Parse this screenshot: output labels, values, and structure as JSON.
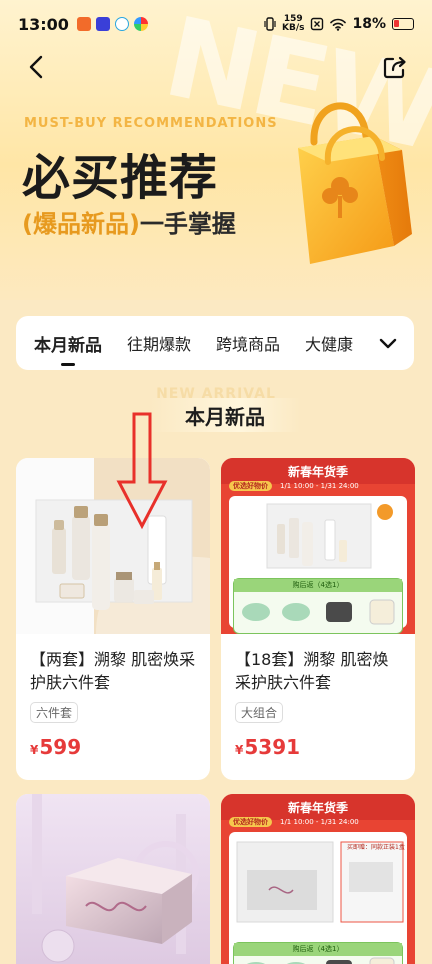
{
  "status_bar": {
    "time": "13:00",
    "net_speed_value": "159",
    "net_speed_unit": "KB/s",
    "battery": "18%"
  },
  "hero": {
    "bg_word": "NEW",
    "en_caption": "MUST-BUY RECOMMENDATIONS",
    "title": "必买推荐",
    "subtitle_accent": "(爆品新品)",
    "subtitle_rest": "一手掌握"
  },
  "tabs": {
    "items": [
      "本月新品",
      "往期爆款",
      "跨境商品",
      "大健康"
    ],
    "active_index": 0
  },
  "section": {
    "ghost_en": "NEW ARRIVAL",
    "title": "本月新品"
  },
  "products": [
    {
      "name": "【两套】溯黎 肌密焕采护肤六件套",
      "tag": "六件套",
      "currency": "¥",
      "price": "599"
    },
    {
      "name": "【18套】溯黎 肌密焕采护肤六件套",
      "tag": "大组合",
      "currency": "¥",
      "price": "5391",
      "promo_title": "新春年货季",
      "promo_pill": "优选好物价",
      "promo_date": "1/1 10:00 - 1/31 24:00",
      "gift_title": "购后返（4选1）"
    },
    {
      "name": "",
      "tag": "",
      "price": ""
    },
    {
      "promo_title": "新春年货季",
      "promo_pill": "优选好物价",
      "promo_date": "1/1 10:00 - 1/31 24:00",
      "gift_title": "购后返（4选1）",
      "gift_side": "买即赠：同款正装1盒"
    }
  ],
  "colors": {
    "accent_orange": "#e79a1f",
    "price_red": "#e63a3a",
    "promo_red": "#d7342c",
    "arrow_red": "#e8302a"
  }
}
